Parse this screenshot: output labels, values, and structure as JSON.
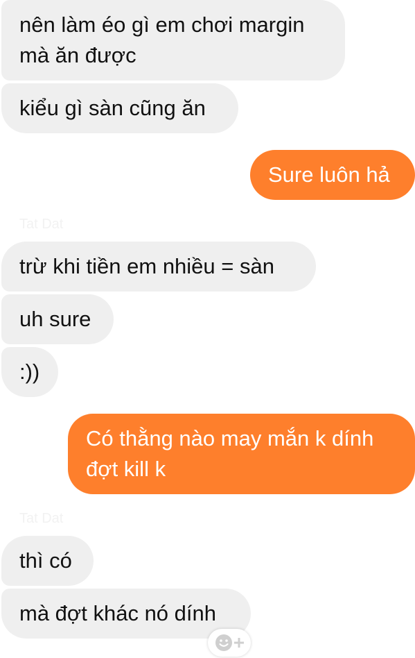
{
  "conversation": {
    "groups": [
      {
        "messages": [
          {
            "text": "nên làm éo gì em chơi margin\nmà ăn được"
          },
          {
            "text": "kiểu gì sàn cũng ăn"
          }
        ]
      },
      {
        "messages": [
          {
            "text": "Sure luôn hả"
          }
        ]
      },
      {
        "sender": "Tat Dat",
        "messages": [
          {
            "text": "trừ khi tiền em nhiều = sàn"
          },
          {
            "text": "uh sure"
          },
          {
            "text": ":))"
          }
        ]
      },
      {
        "messages": [
          {
            "text": "Có thằng nào may mắn k dính\nđợt kill k"
          }
        ]
      },
      {
        "sender": "Tat Dat",
        "messages": [
          {
            "text": "thì có"
          },
          {
            "text": "mà đợt khác nó dính"
          }
        ]
      }
    ]
  },
  "reaction_button": {
    "icon": "add-reaction-icon"
  },
  "colors": {
    "incoming_bubble": "#efefef",
    "outgoing_bubble": "#fe7f2c",
    "incoming_text": "#111111",
    "outgoing_text": "#ffffff"
  }
}
